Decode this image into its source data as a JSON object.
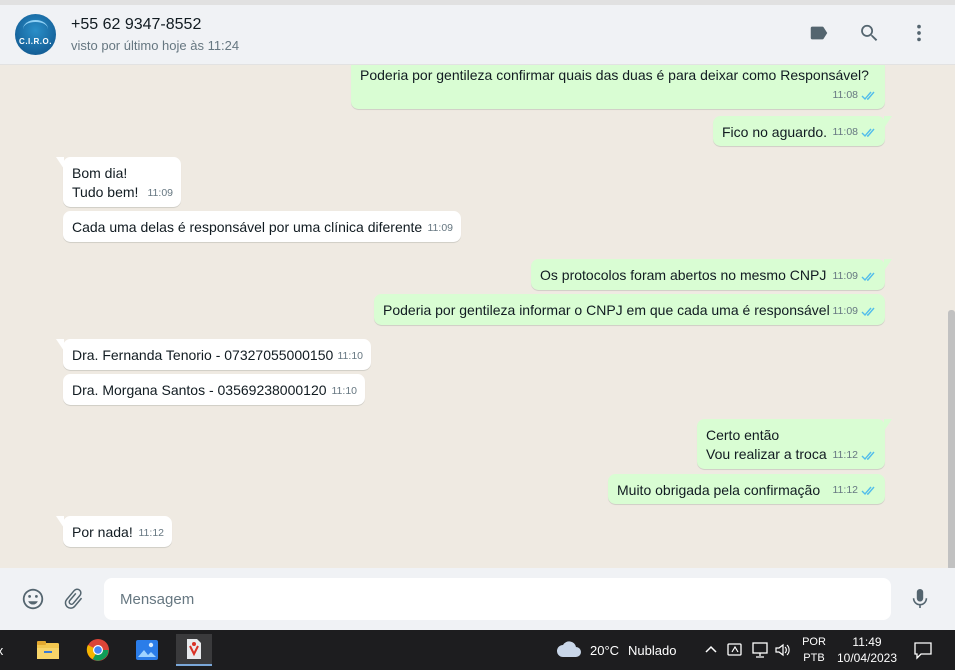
{
  "header": {
    "contact_name": "+55 62 9347-8552",
    "status": "visto por último hoje às 11:24",
    "avatar_text": "C.I.R.O."
  },
  "messages": [
    {
      "dir": "out",
      "text": "Poderia por gentileza confirmar quais das duas é para deixar como Responsável?",
      "time": "11:08",
      "read": true
    },
    {
      "dir": "out",
      "text": "Fico no aguardo.",
      "time": "11:08",
      "read": true
    },
    {
      "dir": "in",
      "text": "Bom dia!\nTudo bem!",
      "time": "11:09"
    },
    {
      "dir": "in",
      "text": "Cada uma delas é responsável por uma clínica diferente",
      "time": "11:09"
    },
    {
      "dir": "out",
      "text": "Os protocolos foram abertos no mesmo CNPJ",
      "time": "11:09",
      "read": true
    },
    {
      "dir": "out",
      "text": "Poderia por gentileza informar o CNPJ em que cada uma é responsável",
      "time": "11:09",
      "read": true
    },
    {
      "dir": "in",
      "text": "Dra. Fernanda Tenorio - 07327055000150",
      "time": "11:10"
    },
    {
      "dir": "in",
      "text": "Dra. Morgana Santos - 03569238000120",
      "time": "11:10"
    },
    {
      "dir": "out",
      "text": "Certo então\nVou realizar a troca",
      "time": "11:12",
      "read": true
    },
    {
      "dir": "out",
      "text": "Muito obrigada pela confirmação",
      "time": "11:12",
      "read": true
    },
    {
      "dir": "in",
      "text": "Por nada!",
      "time": "11:12"
    }
  ],
  "composer": {
    "placeholder": "Mensagem"
  },
  "taskbar": {
    "left_fragment": "x",
    "weather_temp": "20°C",
    "weather_desc": "Nublado",
    "lang": "POR",
    "layout": "PTB",
    "time": "11:49",
    "date": "10/04/2023"
  },
  "icons": {
    "label": "label-icon",
    "search": "search-icon",
    "menu": "kebab-menu-icon",
    "emoji": "emoji-icon",
    "attach": "paperclip-icon",
    "mic": "microphone-icon"
  },
  "colors": {
    "outgoing_bubble": "#d9fdd3",
    "incoming_bubble": "#ffffff",
    "chat_background": "#efeae2",
    "read_ticks": "#53bdeb"
  }
}
